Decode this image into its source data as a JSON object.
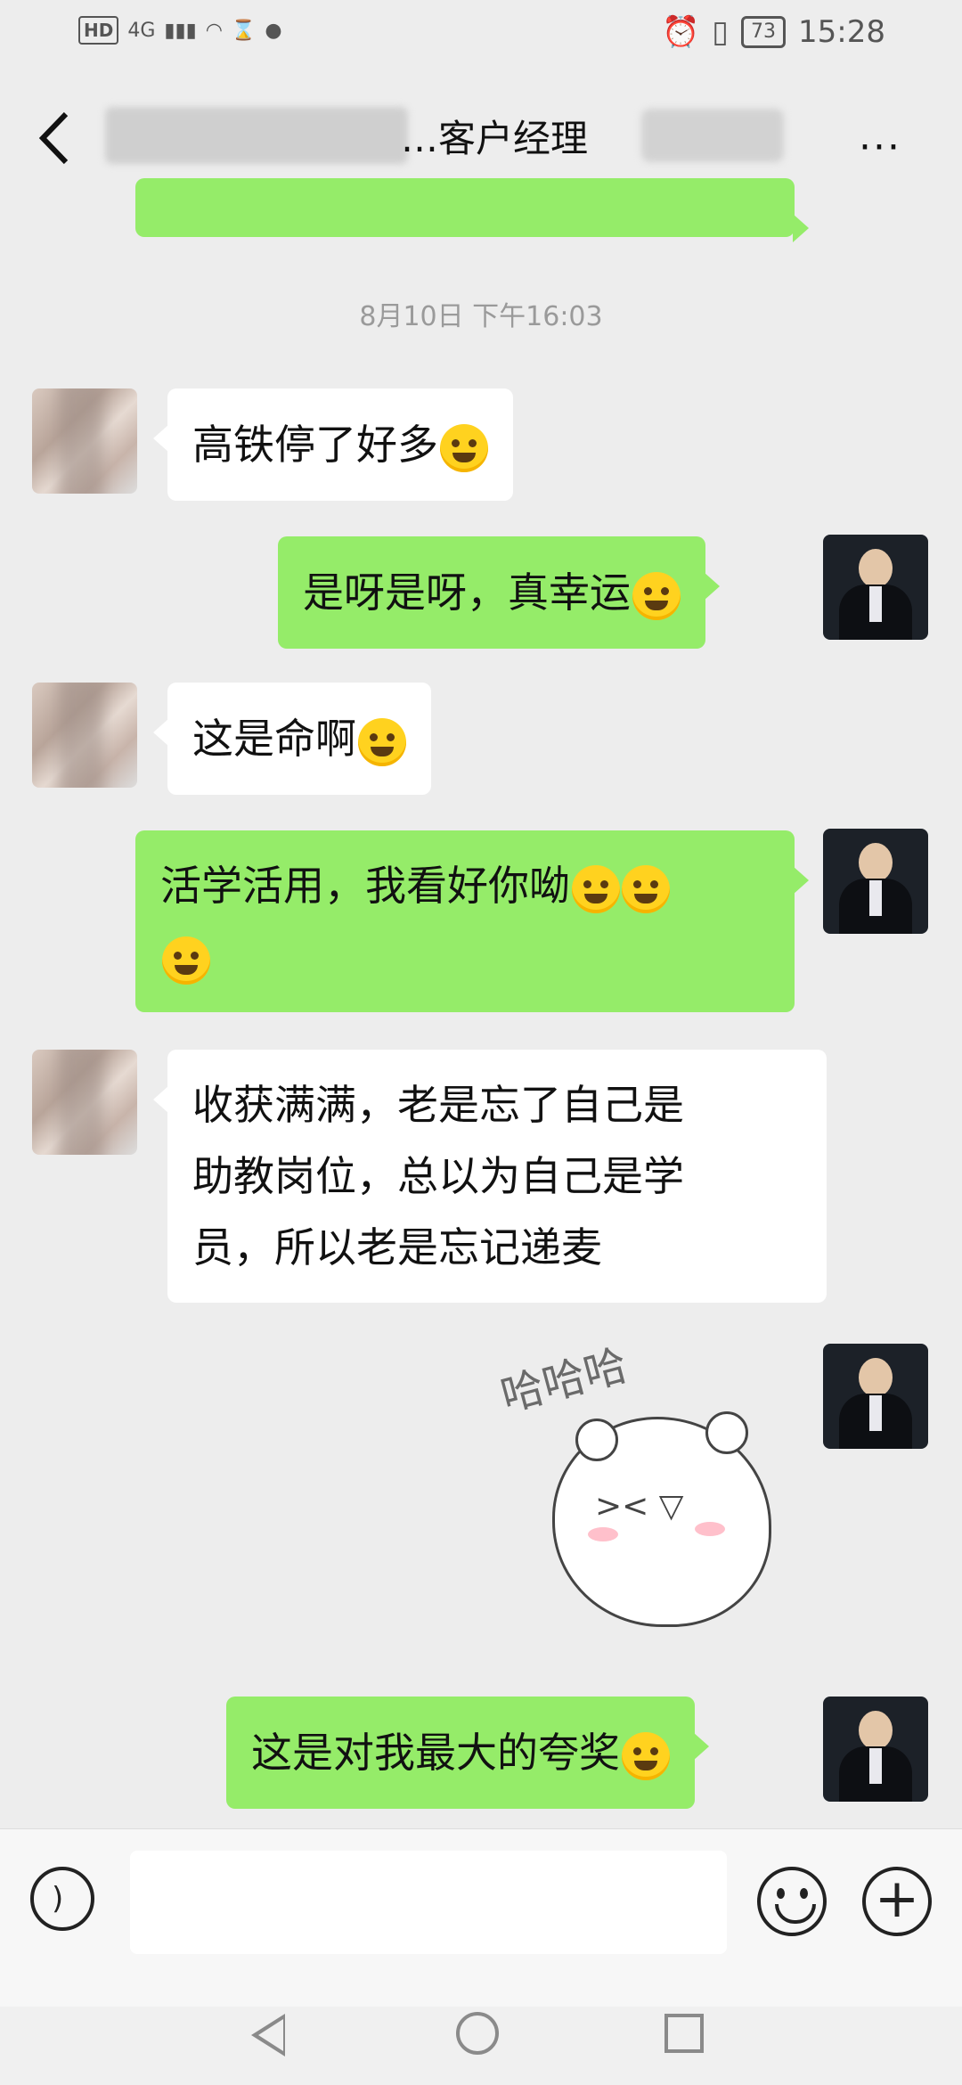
{
  "status_bar": {
    "hd": "HD",
    "network": "4G",
    "battery": "73",
    "time": "15:28"
  },
  "header": {
    "title": "…客户经理",
    "back_icon": "chevron-left-icon",
    "more": "···"
  },
  "messages": {
    "timestamp": "8月10日 下午16:03",
    "m1": "高铁停了好多",
    "m2": "是呀是呀，真幸运",
    "m3": "这是命啊",
    "m4_line1": "活学活用，我看好你呦",
    "m5_line1": "收获满满，老是忘了自己是",
    "m5_line2": "助教岗位，总以为自己是学",
    "m5_line3": "员，所以老是忘记递麦",
    "sticker_text": "哈哈哈",
    "m6": "这是对我最大的夸奖"
  },
  "colors": {
    "background": "#ededed",
    "outgoing_bubble": "#95ec69",
    "incoming_bubble": "#ffffff"
  },
  "input_bar": {
    "voice_icon": "voice-icon",
    "emoji_icon": "emoji-icon",
    "plus_icon": "plus-icon",
    "plus_label": "+"
  }
}
